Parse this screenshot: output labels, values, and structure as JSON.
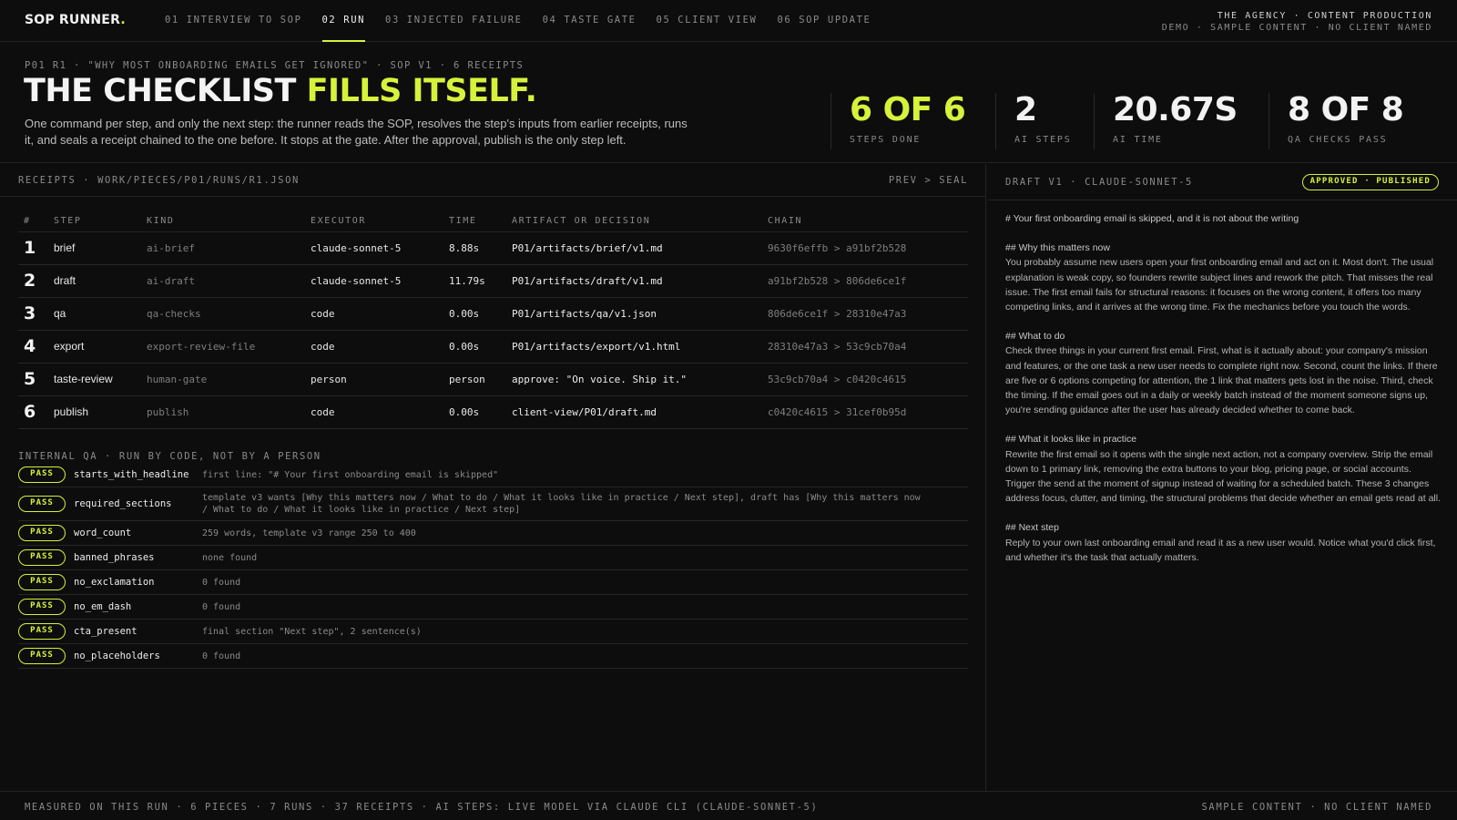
{
  "brand": {
    "name": "SOP RUNNER",
    "dot": "."
  },
  "nav": [
    {
      "label": "01 INTERVIEW TO SOP",
      "active": false
    },
    {
      "label": "02 RUN",
      "active": true
    },
    {
      "label": "03 INJECTED FAILURE",
      "active": false
    },
    {
      "label": "04 TASTE GATE",
      "active": false
    },
    {
      "label": "05 CLIENT VIEW",
      "active": false
    },
    {
      "label": "06 SOP UPDATE",
      "active": false
    }
  ],
  "top_right": {
    "line1": "THE AGENCY · CONTENT PRODUCTION",
    "line2": "DEMO · SAMPLE CONTENT · NO CLIENT NAMED"
  },
  "header": {
    "crumb": "P01 R1 · \"WHY MOST ONBOARDING EMAILS GET IGNORED\" · SOP V1 · 6 RECEIPTS",
    "headline_plain": "THE CHECKLIST",
    "headline_accent": "FILLS ITSELF.",
    "subtitle": "One command per step, and only the next step: the runner reads the SOP, resolves the step's inputs from earlier receipts, runs it, and seals a receipt chained to the one before. It stops at the gate. After the approval, publish is the only step left."
  },
  "stats": [
    {
      "value": "6 OF 6",
      "label": "STEPS DONE",
      "accent": true
    },
    {
      "value": "2",
      "label": "AI STEPS",
      "accent": false
    },
    {
      "value": "20.67S",
      "label": "AI TIME",
      "accent": false
    },
    {
      "value": "8 OF 8",
      "label": "QA CHECKS PASS",
      "accent": false
    }
  ],
  "receipts": {
    "title": "RECEIPTS · WORK/PIECES/P01/RUNS/R1.JSON",
    "nav": "PREV > SEAL",
    "columns": [
      "#",
      "STEP",
      "KIND",
      "EXECUTOR",
      "TIME",
      "ARTIFACT OR DECISION",
      "CHAIN"
    ],
    "rows": [
      {
        "num": "1",
        "step": "brief",
        "kind": "ai-brief",
        "executor": "claude-sonnet-5",
        "time": "8.88s",
        "artifact": "P01/artifacts/brief/v1.md",
        "chain": "9630f6effb > a91bf2b528"
      },
      {
        "num": "2",
        "step": "draft",
        "kind": "ai-draft",
        "executor": "claude-sonnet-5",
        "time": "11.79s",
        "artifact": "P01/artifacts/draft/v1.md",
        "chain": "a91bf2b528 > 806de6ce1f"
      },
      {
        "num": "3",
        "step": "qa",
        "kind": "qa-checks",
        "executor": "code",
        "time": "0.00s",
        "artifact": "P01/artifacts/qa/v1.json",
        "chain": "806de6ce1f > 28310e47a3"
      },
      {
        "num": "4",
        "step": "export",
        "kind": "export-review-file",
        "executor": "code",
        "time": "0.00s",
        "artifact": "P01/artifacts/export/v1.html",
        "chain": "28310e47a3 > 53c9cb70a4"
      },
      {
        "num": "5",
        "step": "taste-review",
        "kind": "human-gate",
        "executor": "person",
        "time": "person",
        "artifact": "approve: \"On voice. Ship it.\"",
        "chain": "53c9cb70a4 > c0420c4615"
      },
      {
        "num": "6",
        "step": "publish",
        "kind": "publish",
        "executor": "code",
        "time": "0.00s",
        "artifact": "client-view/P01/draft.md",
        "chain": "c0420c4615 > 31cef0b95d"
      }
    ]
  },
  "qa": {
    "title": "INTERNAL QA · RUN BY CODE, NOT BY A PERSON",
    "badge": "PASS",
    "checks": [
      {
        "name": "starts_with_headline",
        "detail": "first line: \"# Your first onboarding email is skipped\""
      },
      {
        "name": "required_sections",
        "detail": "template v3 wants [Why this matters now / What to do / What it looks like in practice / Next step], draft has [Why this matters now / What to do / What it looks like in practice / Next step]"
      },
      {
        "name": "word_count",
        "detail": "259 words, template v3 range 250 to 400"
      },
      {
        "name": "banned_phrases",
        "detail": "none found"
      },
      {
        "name": "no_exclamation",
        "detail": "0 found"
      },
      {
        "name": "no_em_dash",
        "detail": "0 found"
      },
      {
        "name": "cta_present",
        "detail": "final section \"Next step\", 2 sentence(s)"
      },
      {
        "name": "no_placeholders",
        "detail": "0 found"
      }
    ]
  },
  "draft": {
    "title": "DRAFT V1 · CLAUDE-SONNET-5",
    "status": "APPROVED · PUBLISHED",
    "h1": "# Your first onboarding email is skipped, and it is not about the writing",
    "s1_h": "## Why this matters now",
    "s1_p": "You probably assume new users open your first onboarding email and act on it. Most don't. The usual explanation is weak copy, so founders rewrite subject lines and rework the pitch. That misses the real issue. The first email fails for structural reasons: it focuses on the wrong content, it offers too many competing links, and it arrives at the wrong time. Fix the mechanics before you touch the words.",
    "s2_h": "## What to do",
    "s2_p": "Check three things in your current first email. First, what is it actually about: your company's mission and features, or the one task a new user needs to complete right now. Second, count the links. If there are five or 6 options competing for attention, the 1 link that matters gets lost in the noise. Third, check the timing. If the email goes out in a daily or weekly batch instead of the moment someone signs up, you're sending guidance after the user has already decided whether to come back.",
    "s3_h": "## What it looks like in practice",
    "s3_p": "Rewrite the first email so it opens with the single next action, not a company overview. Strip the email down to 1 primary link, removing the extra buttons to your blog, pricing page, or social accounts. Trigger the send at the moment of signup instead of waiting for a scheduled batch. These 3 changes address focus, clutter, and timing, the structural problems that decide whether an email gets read at all.",
    "s4_h": "## Next step",
    "s4_p": "Reply to your own last onboarding email and read it as a new user would. Notice what you'd click first, and whether it's the task that actually matters."
  },
  "footer": {
    "left": "MEASURED ON THIS RUN · 6 PIECES · 7 RUNS · 37 RECEIPTS · AI STEPS: LIVE MODEL VIA CLAUDE CLI (CLAUDE-SONNET-5)",
    "right": "SAMPLE CONTENT · NO CLIENT NAMED"
  },
  "colors": {
    "accent": "#d6f23a",
    "background": "#0d0d0d"
  }
}
